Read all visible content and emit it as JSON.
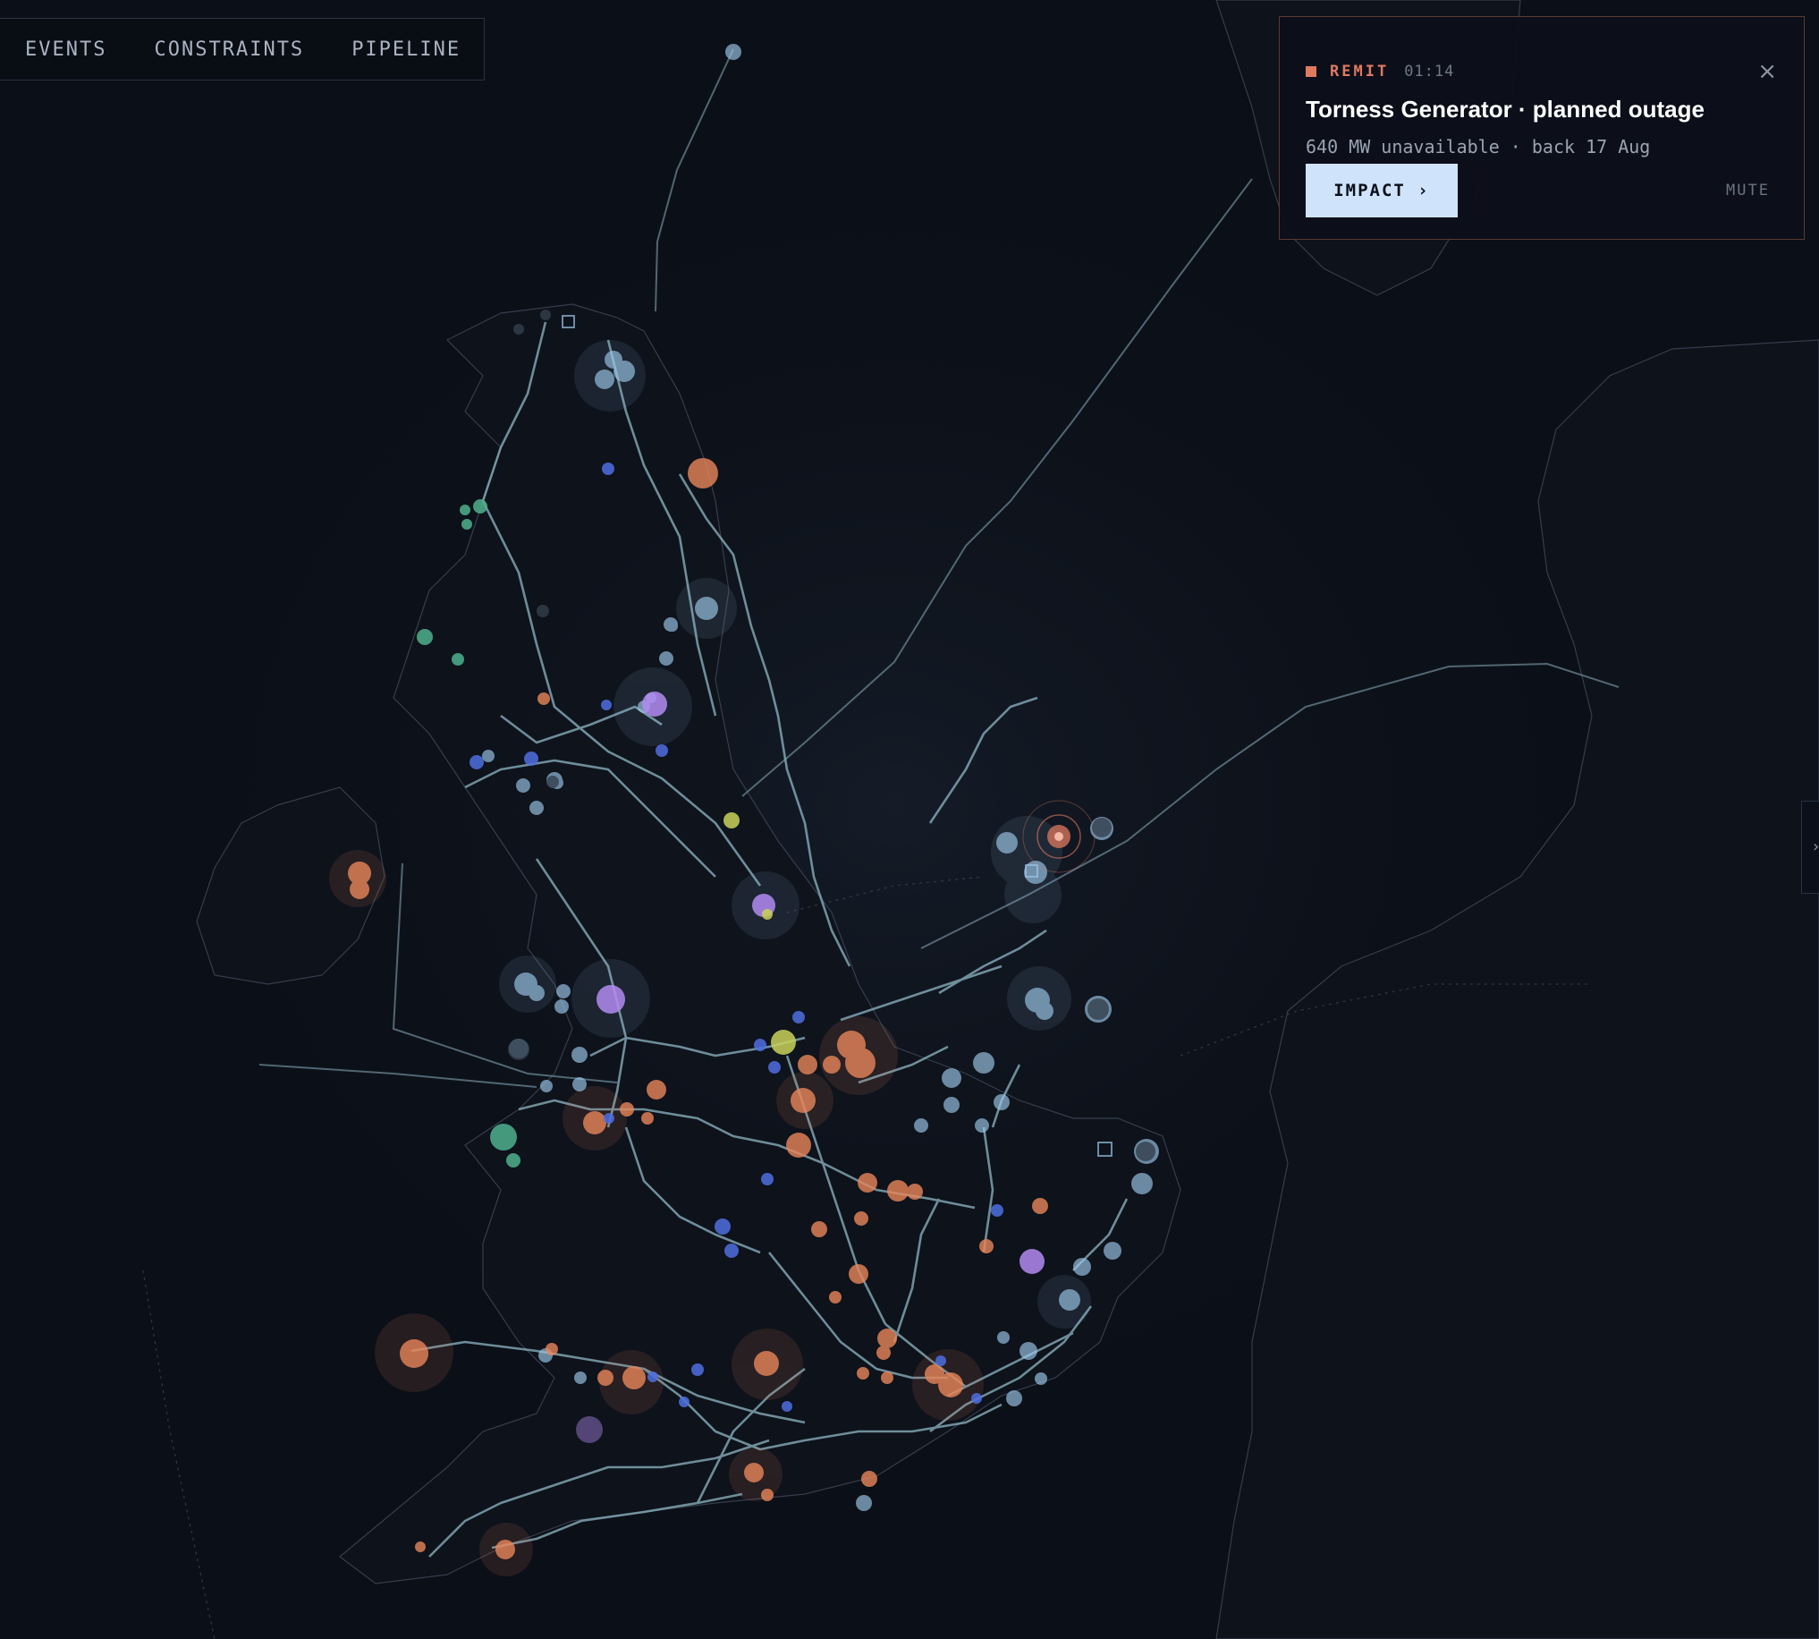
{
  "nav": {
    "tabs": [
      {
        "label": "EVENTS"
      },
      {
        "label": "CONSTRAINTS"
      },
      {
        "label": "PIPELINE"
      }
    ]
  },
  "alert": {
    "tag": "REMIT",
    "time": "01:14",
    "title": "Torness Generator · planned outage",
    "subtitle": "640 MW unavailable · back 17 Aug",
    "impact_label": "IMPACT ›",
    "mute_label": "MUTE",
    "close_glyph": "×"
  },
  "edge_tab": {
    "glyph": "›"
  },
  "colors": {
    "background": "#0b0f17",
    "land": "#0f141d",
    "coastline": "#3a4352",
    "line": "#8fb6c4",
    "link": "#8aa8b8",
    "remit": "#e07a5f",
    "accent": "#cfe4fb"
  },
  "legend_colors": {
    "gas": "#e8865a",
    "wind": "#9ec9ea",
    "nuclear": "#b48cf2",
    "hydro": "#4fb08c",
    "interconnector": "#4f6fe0",
    "biomass": "#c9d25a"
  }
}
